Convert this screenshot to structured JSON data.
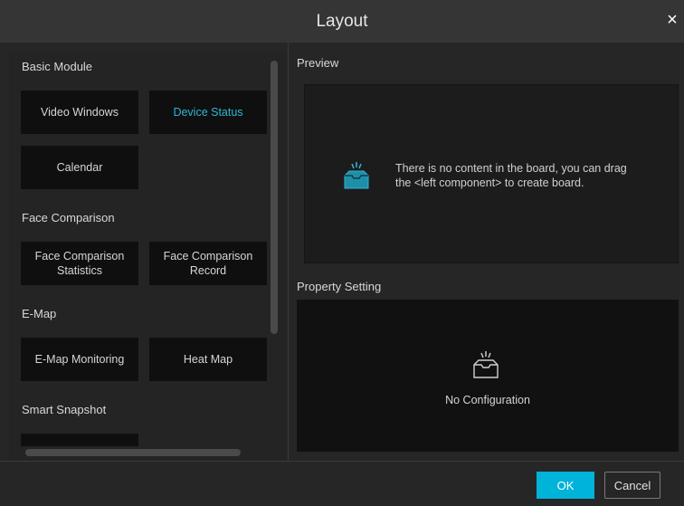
{
  "window": {
    "title": "Layout",
    "close_glyph": "×"
  },
  "left_panel": {
    "sections": [
      {
        "label": "Basic Module"
      },
      {
        "label": "Face Comparison"
      },
      {
        "label": "E-Map"
      },
      {
        "label": "Smart Snapshot"
      }
    ],
    "tiles": {
      "video_windows": "Video Windows",
      "device_status": "Device Status",
      "calendar": "Calendar",
      "face_comparison_statistics": "Face Comparison Statistics",
      "face_comparison_record": "Face Comparison Record",
      "emap_monitoring": "E-Map Monitoring",
      "heat_map": "Heat Map"
    },
    "active_tile": "device_status"
  },
  "preview": {
    "label": "Preview",
    "icon": "empty-tray-icon",
    "message_line1": "There is no content in the board, you can drag",
    "message_line2": "the <left component> to create board."
  },
  "property_setting": {
    "label": "Property Setting",
    "icon": "empty-tray-icon",
    "message": "No Configuration"
  },
  "buttons": {
    "ok": "OK",
    "cancel": "Cancel"
  },
  "colors": {
    "accent": "#00b3d9",
    "active_text": "#2fb6d6",
    "background": "#262626",
    "tile": "#0f0f0f"
  }
}
